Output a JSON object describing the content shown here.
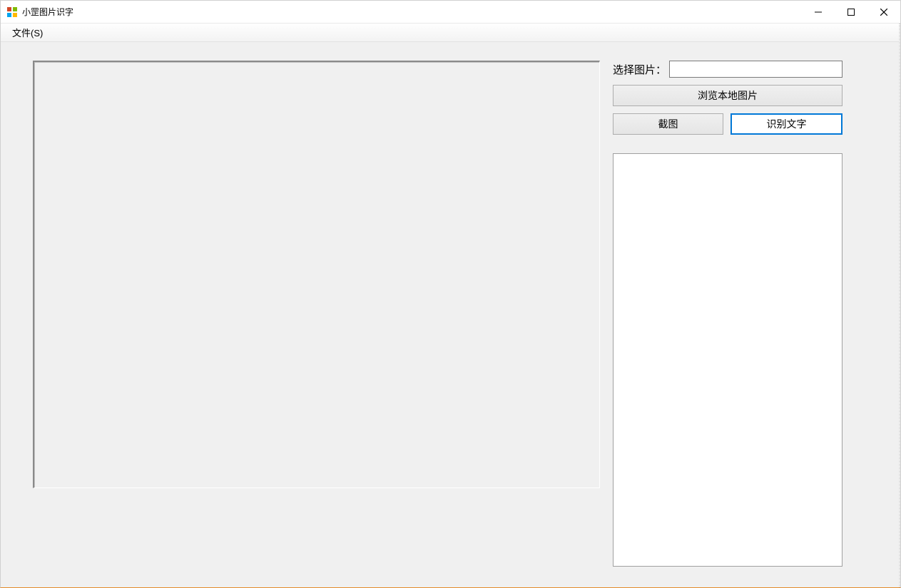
{
  "window": {
    "title": "小罡图片识字"
  },
  "menu": {
    "file": "文件(S)"
  },
  "side": {
    "select_image_label": "选择图片：",
    "image_path_value": "",
    "browse_button": "浏览本地图片",
    "screenshot_button": "截图",
    "recognize_button": "识别文字",
    "result_text": ""
  }
}
